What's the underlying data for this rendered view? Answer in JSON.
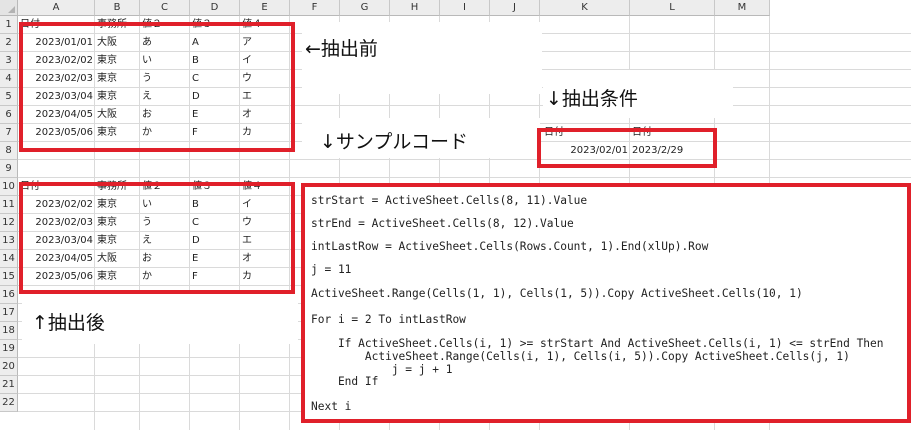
{
  "columns": [
    "A",
    "B",
    "C",
    "D",
    "E",
    "F",
    "G",
    "H",
    "I",
    "J",
    "K",
    "L",
    "M"
  ],
  "rows": [
    "1",
    "2",
    "3",
    "4",
    "5",
    "6",
    "7",
    "8",
    "9",
    "10",
    "11",
    "12",
    "13",
    "14",
    "15",
    "16",
    "17",
    "18",
    "19",
    "20",
    "21",
    "22"
  ],
  "top_table": {
    "headers": [
      "日付",
      "事務所",
      "値２",
      "値３",
      "値４"
    ],
    "rows": [
      [
        "2023/01/01",
        "大阪",
        "あ",
        "A",
        "ア"
      ],
      [
        "2023/02/02",
        "東京",
        "い",
        "B",
        "イ"
      ],
      [
        "2023/02/03",
        "東京",
        "う",
        "C",
        "ウ"
      ],
      [
        "2023/03/04",
        "東京",
        "え",
        "D",
        "エ"
      ],
      [
        "2023/04/05",
        "大阪",
        "お",
        "E",
        "オ"
      ],
      [
        "2023/05/06",
        "東京",
        "か",
        "F",
        "カ"
      ]
    ]
  },
  "bottom_table": {
    "headers": [
      "日付",
      "事務所",
      "値２",
      "値３",
      "値４"
    ],
    "rows": [
      [
        "2023/02/02",
        "東京",
        "い",
        "B",
        "イ"
      ],
      [
        "2023/02/03",
        "東京",
        "う",
        "C",
        "ウ"
      ],
      [
        "2023/03/04",
        "東京",
        "え",
        "D",
        "エ"
      ],
      [
        "2023/04/05",
        "大阪",
        "お",
        "E",
        "オ"
      ],
      [
        "2023/05/06",
        "東京",
        "か",
        "F",
        "カ"
      ]
    ]
  },
  "condition_table": {
    "headers": [
      "日付",
      "日付"
    ],
    "values": [
      "2023/02/01",
      "2023/2/29"
    ]
  },
  "annotations": {
    "before": "←抽出前",
    "condition": "↓抽出条件",
    "sample_code": "↓サンプルコード",
    "after": "↑抽出後"
  },
  "code_lines": [
    "strStart = ActiveSheet.Cells(8, 11).Value",
    "strEnd = ActiveSheet.Cells(8, 12).Value",
    "intLastRow = ActiveSheet.Cells(Rows.Count, 1).End(xlUp).Row",
    "j = 11",
    "ActiveSheet.Range(Cells(1, 1), Cells(1, 5)).Copy ActiveSheet.Cells(10, 1)",
    "For i = 2 To intLastRow",
    "    If ActiveSheet.Cells(i, 1) >= strStart And ActiveSheet.Cells(i, 1) <= strEnd Then",
    "        ActiveSheet.Range(Cells(i, 1), Cells(i, 5)).Copy ActiveSheet.Cells(j, 1)",
    "            j = j + 1",
    "    End If",
    "Next i"
  ],
  "colors": {
    "highlight_border": "#e0202a",
    "grid_line": "#dadada",
    "header_bg": "#ededed"
  }
}
